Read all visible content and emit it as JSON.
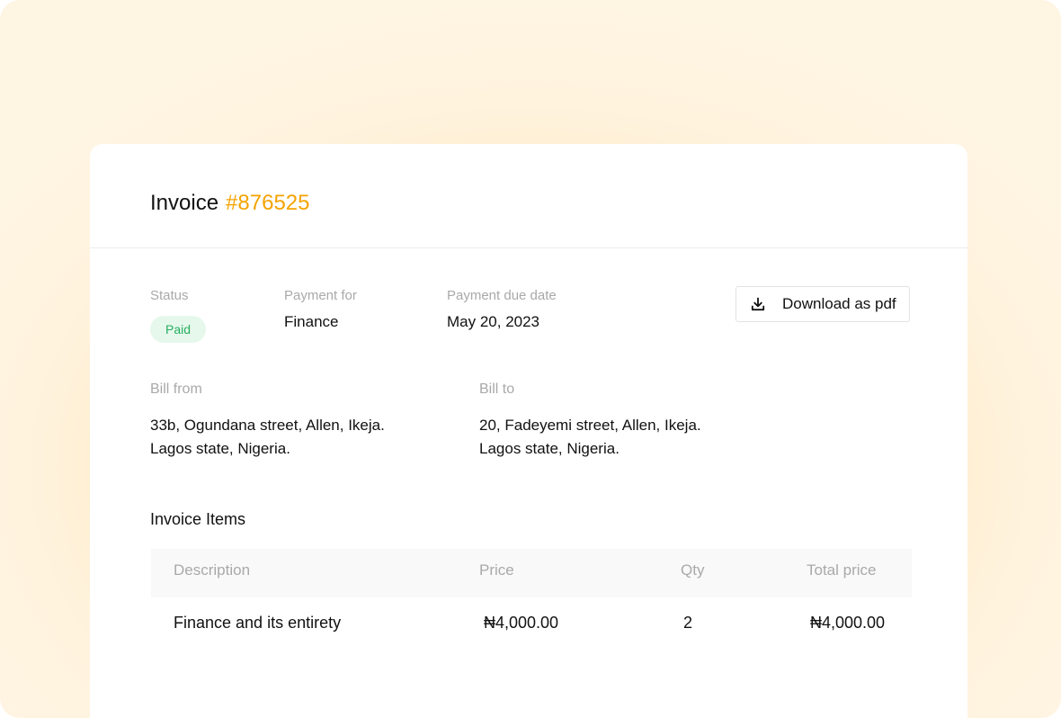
{
  "header": {
    "title": "Invoice",
    "invoice_number": "#876525"
  },
  "summary": {
    "status_label": "Status",
    "status_value": "Paid",
    "payment_for_label": "Payment for",
    "payment_for_value": "Finance",
    "due_date_label": "Payment due date",
    "due_date_value": "May 20, 2023",
    "download_label": "Download as pdf",
    "download_icon": "download-icon"
  },
  "billing": {
    "from_label": "Bill from",
    "from_line1": "33b, Ogundana street, Allen, Ikeja.",
    "from_line2": "Lagos state, Nigeria.",
    "to_label": "Bill to",
    "to_line1": "20, Fadeyemi street, Allen, Ikeja.",
    "to_line2": "Lagos state, Nigeria."
  },
  "items": {
    "section_title": "Invoice Items",
    "columns": [
      "Description",
      "Price",
      "Qty",
      "Total price"
    ],
    "rows": [
      {
        "description": "Finance and its entirety",
        "price": "₦4,000.00",
        "qty": "2",
        "total": "₦4,000.00"
      }
    ]
  },
  "colors": {
    "accent": "#f5a300",
    "paid_text": "#27ae60",
    "paid_bg": "#e6f8ec",
    "backdrop": "#ffe8c0"
  }
}
